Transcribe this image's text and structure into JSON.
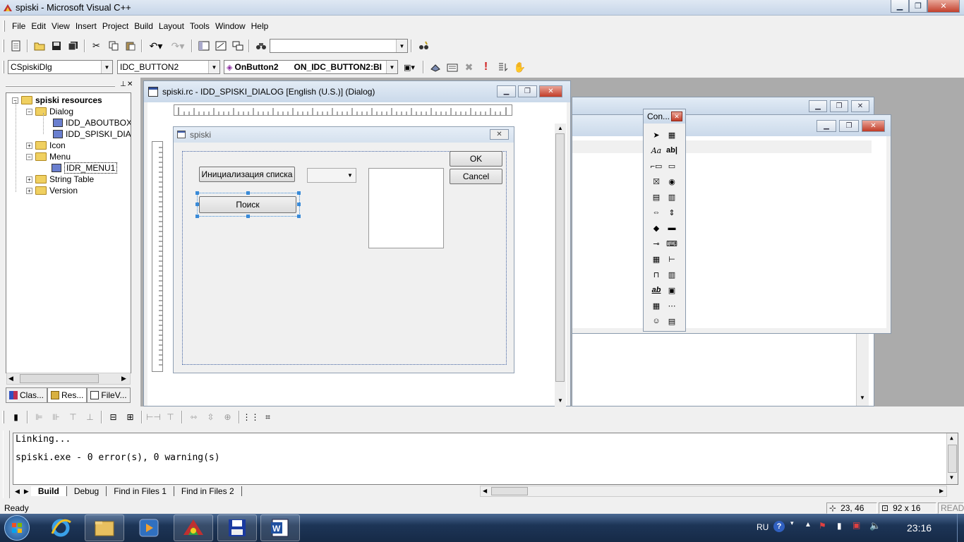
{
  "window": {
    "title": "spiski - Microsoft Visual C++"
  },
  "menu": [
    "File",
    "Edit",
    "View",
    "Insert",
    "Project",
    "Build",
    "Layout",
    "Tools",
    "Window",
    "Help"
  ],
  "toolbar2": {
    "class_combo": "CSpiskiDlg",
    "id_combo": "IDC_BUTTON2",
    "handler_combo": "OnButton2",
    "handler_combo_id": "ON_IDC_BUTTON2:BI"
  },
  "workspace": {
    "root": "spiski resources",
    "dialog_folder": "Dialog",
    "dialog_items": [
      "IDD_ABOUTBOX [",
      "IDD_SPISKI_DIAL"
    ],
    "icon_folder": "Icon",
    "menu_folder": "Menu",
    "menu_item": "IDR_MENU1",
    "string_folder": "String Table",
    "version_folder": "Version",
    "tabs": [
      "Clas...",
      "Res...",
      "FileV..."
    ]
  },
  "editor": {
    "title": "spiski.rc - IDD_SPISKI_DIALOG [English (U.S.)] (Dialog)"
  },
  "dialog": {
    "title": "spiski",
    "ok": "OK",
    "cancel": "Cancel",
    "init_button": "Инициализация списка",
    "search_button": "Поиск"
  },
  "palette": {
    "title": "Con..."
  },
  "output": {
    "line1": "Linking...",
    "line2": "spiski.exe - 0 error(s), 0 warning(s)",
    "tabs": [
      "Build",
      "Debug",
      "Find in Files 1",
      "Find in Files 2"
    ]
  },
  "status": {
    "text": "Ready",
    "pos": "23, 46",
    "size": "92 x 16",
    "mode": "READ"
  },
  "taskbar": {
    "lang": "RU",
    "clock": "23:16"
  },
  "colors": {
    "selection_handle": "#3a8bd8",
    "close_button": "#c13b27",
    "taskbar": "#1d3557"
  }
}
